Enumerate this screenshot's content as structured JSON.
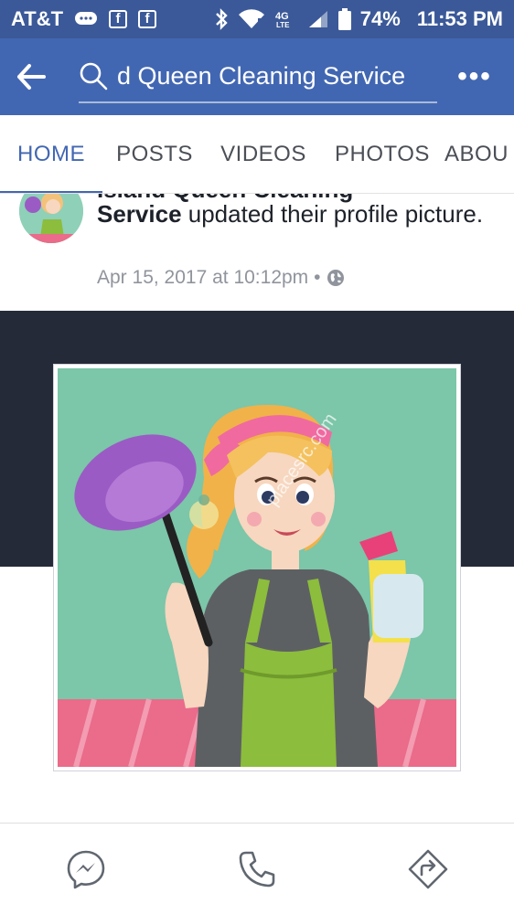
{
  "status_bar": {
    "carrier": "AT&T",
    "battery": "74%",
    "time": "11:53 PM",
    "icons": [
      "messenger-icon",
      "facebook-icon",
      "facebook-icon",
      "bluetooth-icon",
      "wifi-icon",
      "lte-icon",
      "signal-icon",
      "battery-icon"
    ]
  },
  "appbar": {
    "search_text": "d Queen Cleaning Service",
    "more_label": "•••"
  },
  "tabs": [
    {
      "label": "HOME",
      "active": true
    },
    {
      "label": "POSTS",
      "active": false
    },
    {
      "label": "VIDEOS",
      "active": false
    },
    {
      "label": "PHOTOS",
      "active": false
    },
    {
      "label": "ABOU",
      "active": false
    }
  ],
  "post": {
    "page_name_cut": "Island Queen Cleaning",
    "page_name_end": "Service",
    "action_text": " updated their profile picture.",
    "timestamp": "Apr 15, 2017 at 10:12pm",
    "separator": "•",
    "privacy_icon": "globe-icon"
  },
  "image": {
    "watermark": "placesrc.com"
  },
  "actions": [
    "messenger-icon",
    "phone-icon",
    "directions-icon"
  ],
  "colors": {
    "header_blue": "#4267b2",
    "status_blue": "#3b5998",
    "cover_dark": "#242a38",
    "image_bg": "#7cc6a9",
    "counter_pink": "#ea6b8a"
  }
}
